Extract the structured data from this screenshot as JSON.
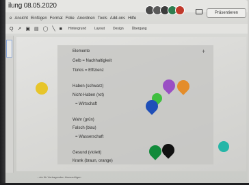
{
  "title_bar": {
    "doc_title": "ilung 08.05.2020",
    "present_label": "Präsentieren",
    "avatars": [
      {
        "initial": "",
        "color": "#4a4a4a"
      },
      {
        "initial": "",
        "color": "#5a5a5a"
      },
      {
        "initial": "",
        "color": "#3c3c3c"
      },
      {
        "initial": "",
        "color": "#2e7d4f"
      },
      {
        "initial": "",
        "color": "#c0392b"
      }
    ]
  },
  "menu": {
    "items": [
      "e",
      "Ansicht",
      "Einfügen",
      "Format",
      "Folie",
      "Anordnen",
      "Tools",
      "Add-ons",
      "Hilfe"
    ]
  },
  "toolbar": {
    "items": [
      "Q",
      "Hintergrund",
      "Layout",
      "Design",
      "Übergang"
    ]
  },
  "slide": {
    "header": "Elemente",
    "lines": [
      "Gelb = Nachhaltigkeit",
      "Türkis = Effizienz",
      "Haben (schwarz)",
      "Nicht-Haben (rot)",
      "= Wirtschaft",
      "Wahr (grün)",
      "Falsch (blau)",
      "= Wasserschaft",
      "Gesund (violett)",
      "Krank (braun, orange)"
    ]
  },
  "shapes": {
    "yellow_circle": "#e7c52a",
    "purple_drop": "#9a4fc4",
    "orange_drop": "#e48d2b",
    "green_leaf": "#3fbf3f",
    "blue_drop": "#1f4fb8",
    "dark_green_drop": "#118a3a",
    "black_drop": "#111111",
    "teal_circle": "#25b6a7"
  },
  "footer": {
    "note": "...ein für Vortragenden hinzuzufügen"
  }
}
